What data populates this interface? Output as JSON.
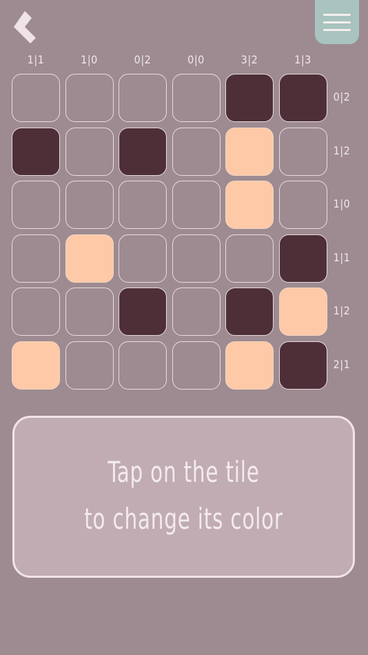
{
  "header": {
    "back_icon": "back-chevron-icon",
    "menu_icon": "hamburger-menu-icon",
    "menu_color": "#a9c3bf"
  },
  "colors": {
    "background": "#9d8b91",
    "dark": "#4e2f38",
    "peach": "#fec9a7",
    "empty_border": "#e9dde0",
    "hint_box": "#c1acb3"
  },
  "puzzle": {
    "column_clues": [
      "1|1",
      "1|0",
      "0|2",
      "0|0",
      "3|2",
      "1|3"
    ],
    "row_clues": [
      "0|2",
      "1|2",
      "1|0",
      "1|1",
      "1|2",
      "2|1"
    ],
    "grid": [
      [
        "empty",
        "empty",
        "empty",
        "empty",
        "dark",
        "dark"
      ],
      [
        "dark",
        "empty",
        "dark",
        "empty",
        "peach",
        "empty"
      ],
      [
        "empty",
        "empty",
        "empty",
        "empty",
        "peach",
        "empty"
      ],
      [
        "empty",
        "peach",
        "empty",
        "empty",
        "empty",
        "dark"
      ],
      [
        "empty",
        "empty",
        "dark",
        "empty",
        "dark",
        "peach"
      ],
      [
        "peach",
        "empty",
        "empty",
        "empty",
        "peach",
        "dark"
      ]
    ]
  },
  "hint": {
    "line1": "Tap on the tile",
    "line2": "to change its color"
  }
}
